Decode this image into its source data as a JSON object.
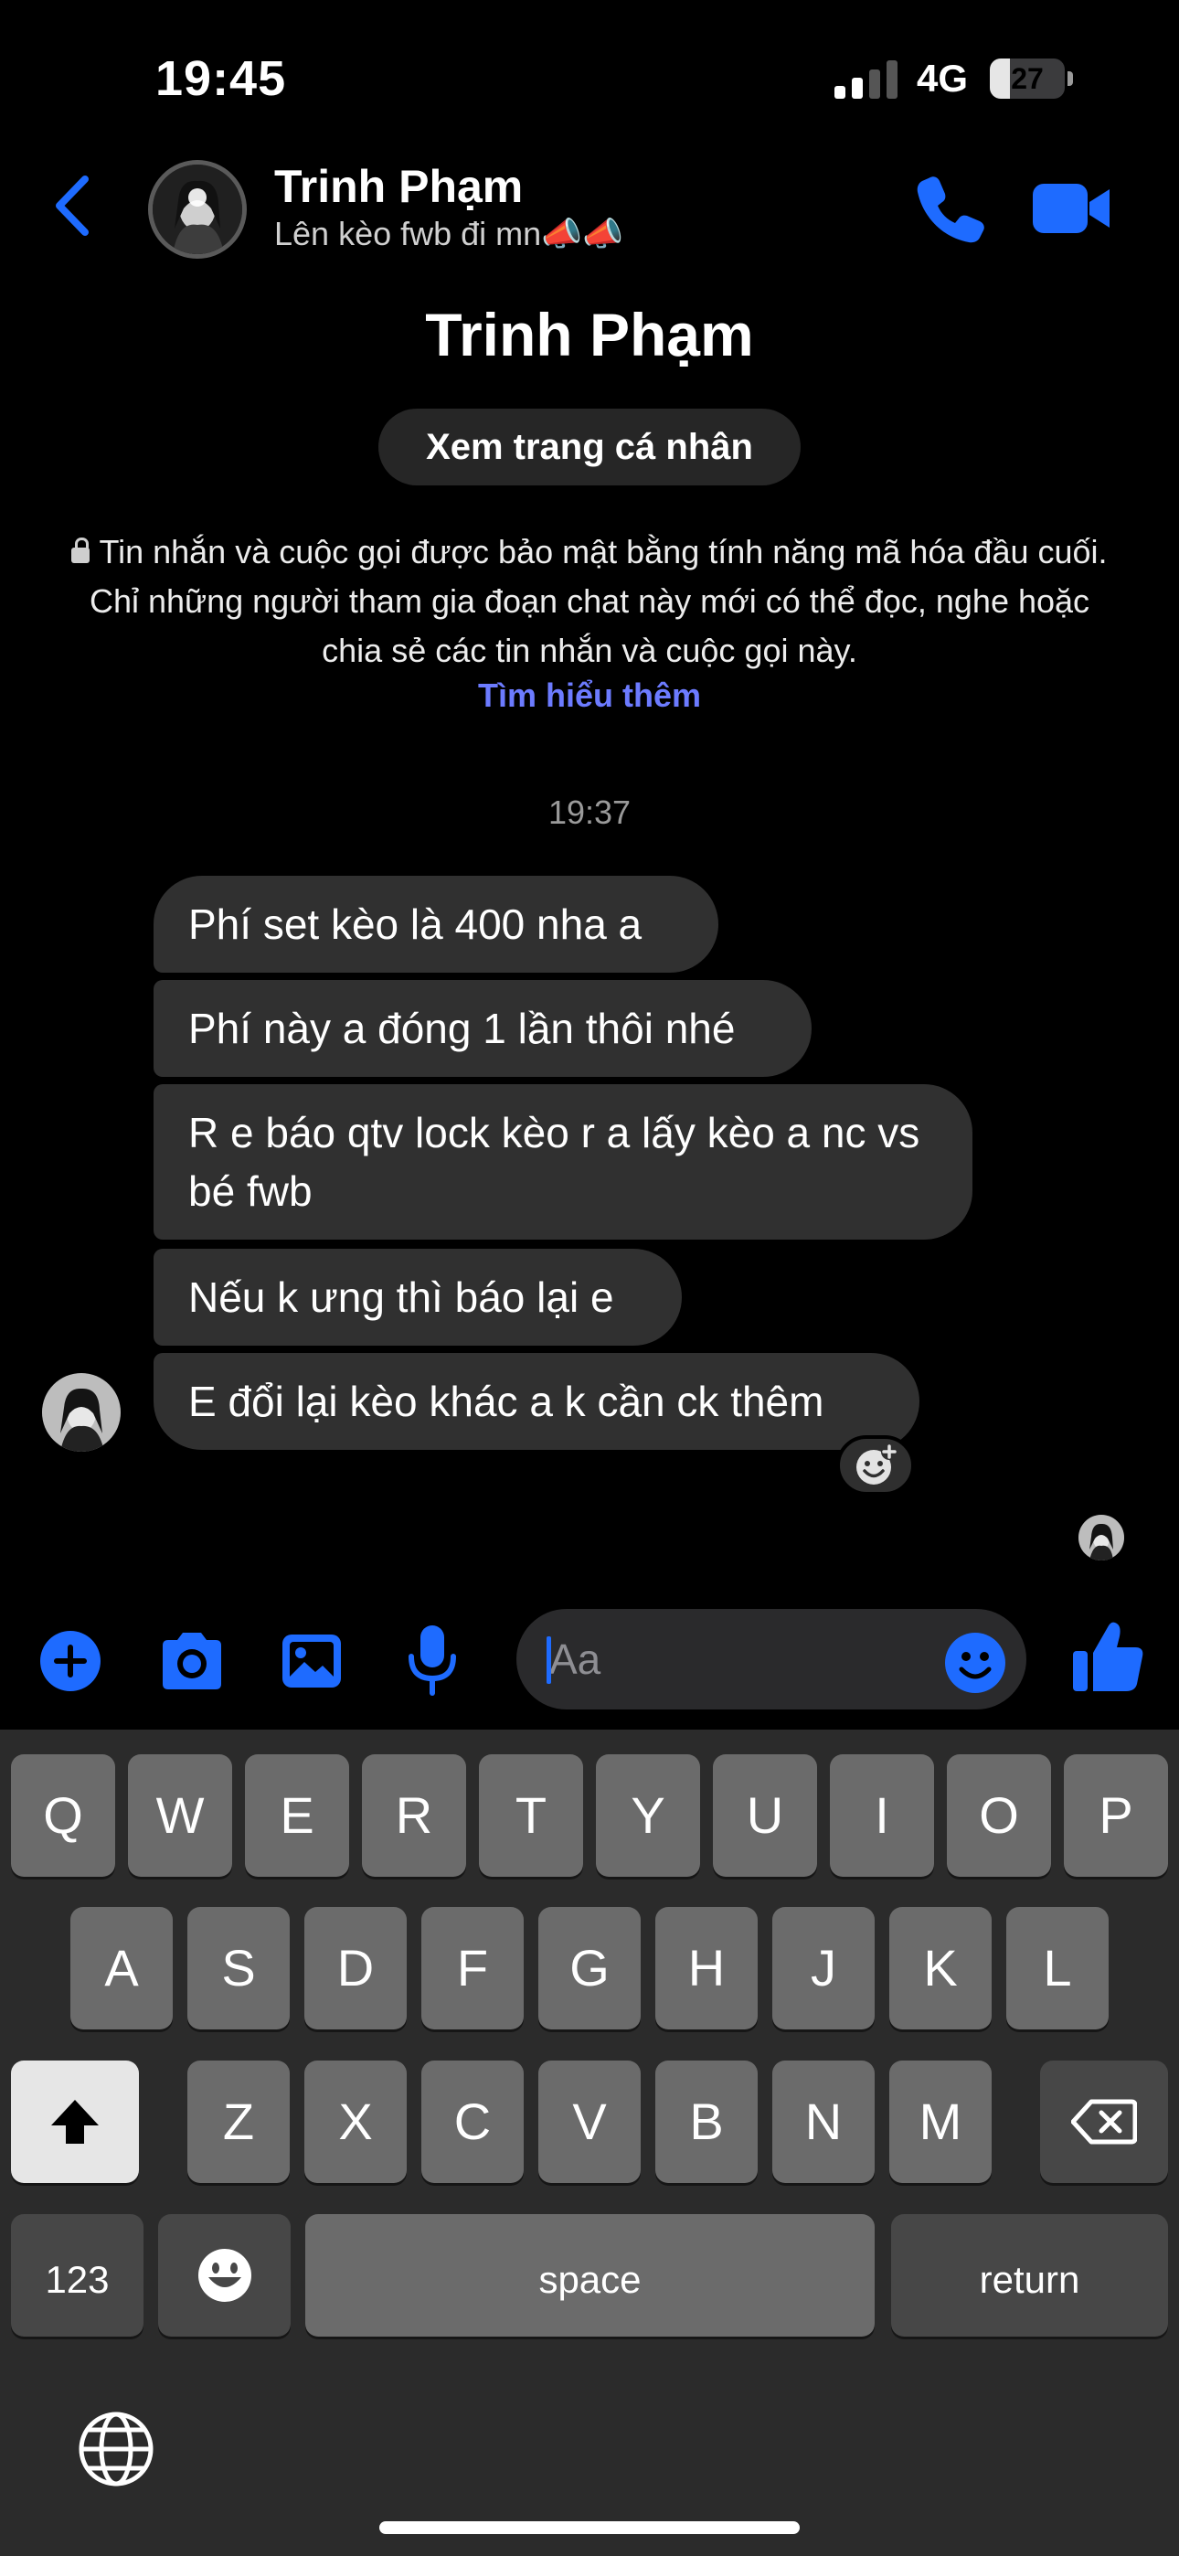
{
  "status_bar": {
    "time": "19:45",
    "network": "4G",
    "battery": "27",
    "battery_level": 0.27
  },
  "header": {
    "name": "Trinh Phạm",
    "status": "Lên kèo fwb đi mn📣📣"
  },
  "intro": {
    "name": "Trinh Phạm",
    "view_profile": "Xem trang cá nhân",
    "e2e_notice": "Tin nhắn và cuộc gọi được bảo mật bằng tính năng mã hóa đầu cuối. Chỉ những người tham gia đoạn chat này mới có thể đọc, nghe hoặc chia sẻ các tin nhắn và cuộc gọi này.",
    "learn_more": "Tìm hiểu thêm"
  },
  "timestamp": "19:37",
  "messages": [
    {
      "text": "Phí set kèo là 400 nha a"
    },
    {
      "text": "Phí này a đóng 1 lần thôi nhé"
    },
    {
      "text": "R e báo qtv lock kèo r a lấy kèo a nc vs bé fwb"
    },
    {
      "text": "Nếu k ưng thì báo lại e"
    },
    {
      "text": "E đổi lại kèo khác a k cần ck thêm"
    }
  ],
  "composer": {
    "placeholder": "Aa"
  },
  "colors": {
    "accent": "#1e6bff",
    "bubble": "#303030",
    "link": "#6c7bff"
  },
  "icons": {
    "back": "chevron-left-icon",
    "call": "phone-icon",
    "video": "video-camera-icon",
    "plus": "plus-circle-icon",
    "camera": "camera-icon",
    "gallery": "image-icon",
    "mic": "microphone-icon",
    "emoji": "smiley-icon",
    "like": "thumbs-up-icon",
    "react": "add-reaction-icon",
    "shift": "shift-icon",
    "delete": "backspace-icon",
    "globe": "globe-icon"
  },
  "keyboard": {
    "row1": [
      "Q",
      "W",
      "E",
      "R",
      "T",
      "Y",
      "U",
      "I",
      "O",
      "P"
    ],
    "row2": [
      "A",
      "S",
      "D",
      "F",
      "G",
      "H",
      "J",
      "K",
      "L"
    ],
    "row3": [
      "Z",
      "X",
      "C",
      "V",
      "B",
      "N",
      "M"
    ],
    "numbers": "123",
    "space": "space",
    "return": "return"
  }
}
